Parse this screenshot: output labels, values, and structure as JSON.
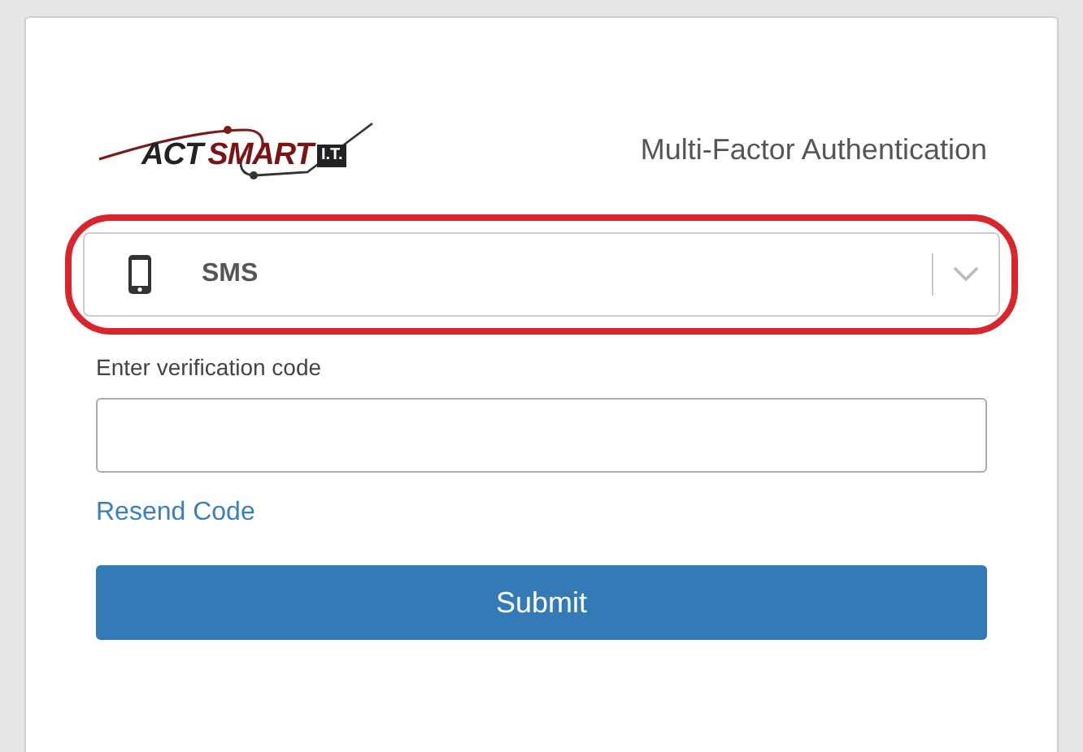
{
  "logo": {
    "part_1": "ACT",
    "part_2": "SMART",
    "badge": "I.T."
  },
  "title": "Multi-Factor Authentication",
  "method_select": {
    "value": "SMS",
    "highlighted": true
  },
  "code_field": {
    "label": "Enter verification code"
  },
  "resend_link": "Resend Code",
  "submit_button": "Submit"
}
